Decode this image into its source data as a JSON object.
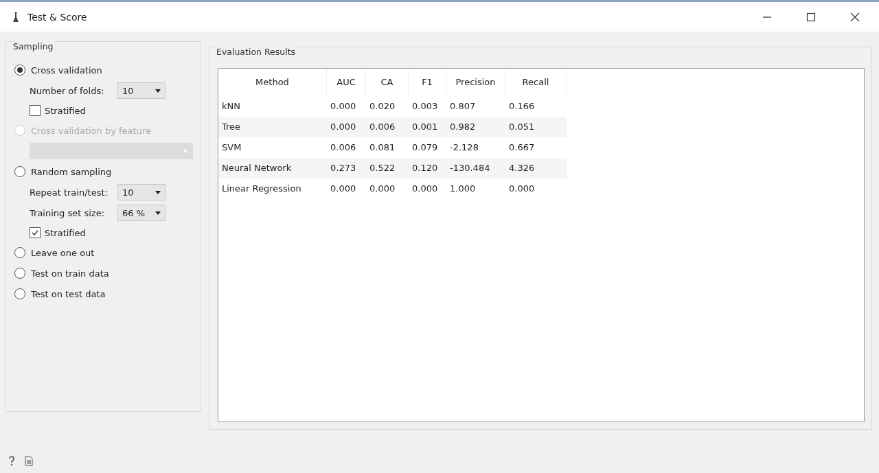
{
  "window": {
    "title": "Test & Score"
  },
  "sampling": {
    "title": "Sampling",
    "options": [
      {
        "label": "Cross validation",
        "selected": true,
        "disabled": false,
        "controls": [
          {
            "kind": "combo",
            "label": "Number of folds:",
            "value": "10",
            "disabled": false
          },
          {
            "kind": "checkbox",
            "label": "Stratified",
            "checked": false
          }
        ]
      },
      {
        "label": "Cross validation by feature",
        "selected": false,
        "disabled": true,
        "controls": [
          {
            "kind": "combo",
            "disabled": true
          }
        ]
      },
      {
        "label": "Random sampling",
        "selected": false,
        "disabled": false,
        "controls": [
          {
            "kind": "combo",
            "label": "Repeat train/test:",
            "value": "10",
            "disabled": false
          },
          {
            "kind": "combo",
            "label": "Training set size:",
            "value": "66 %",
            "disabled": false
          },
          {
            "kind": "checkbox",
            "label": "Stratified",
            "checked": true
          }
        ]
      },
      {
        "label": "Leave one out",
        "selected": false,
        "disabled": false
      },
      {
        "label": "Test on train data",
        "selected": false,
        "disabled": false
      },
      {
        "label": "Test on test data",
        "selected": false,
        "disabled": false
      }
    ]
  },
  "results": {
    "title": "Evaluation Results",
    "columns": [
      "Method",
      "AUC",
      "CA",
      "F1",
      "Precision",
      "Recall"
    ],
    "rows": [
      [
        "kNN",
        "0.000",
        "0.020",
        "0.003",
        "0.807",
        "0.166"
      ],
      [
        "Tree",
        "0.000",
        "0.006",
        "0.001",
        "0.982",
        "0.051"
      ],
      [
        "SVM",
        "0.006",
        "0.081",
        "0.079",
        "-2.128",
        "0.667"
      ],
      [
        "Neural Network",
        "0.273",
        "0.522",
        "0.120",
        "-130.484",
        "4.326"
      ],
      [
        "Linear Regression",
        "0.000",
        "0.000",
        "0.000",
        "1.000",
        "0.000"
      ]
    ]
  }
}
